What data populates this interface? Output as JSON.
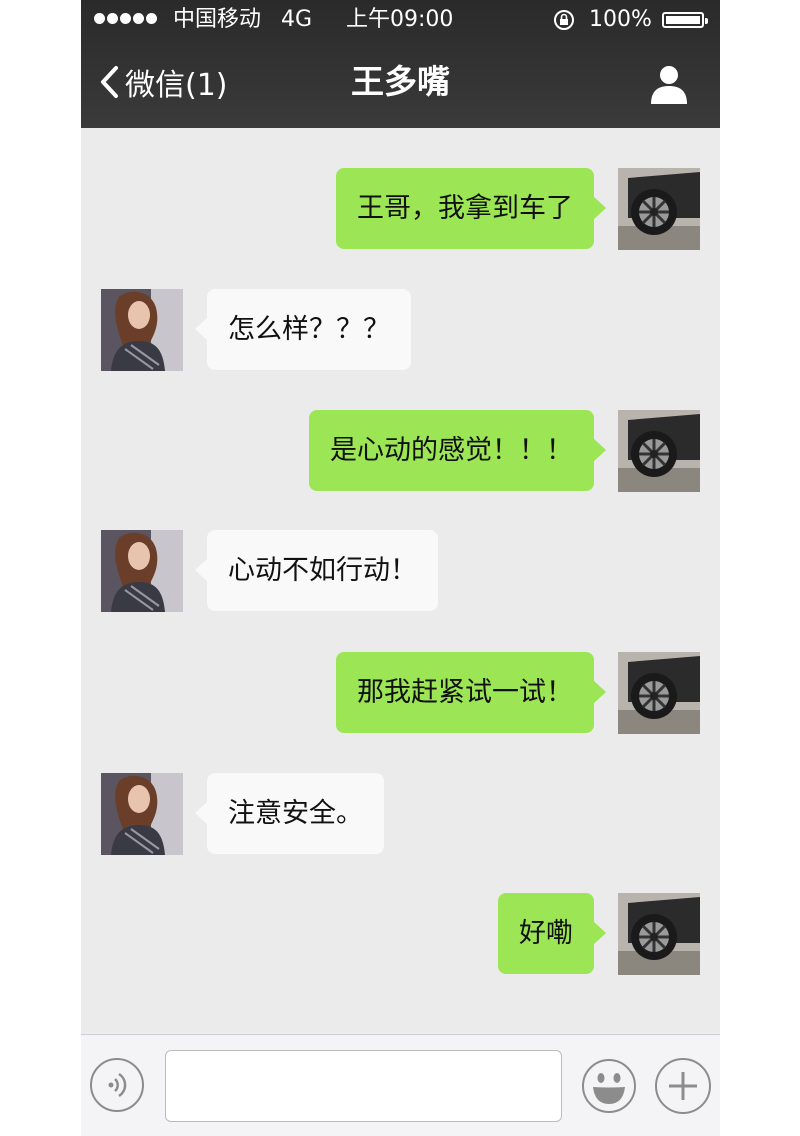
{
  "status_bar": {
    "carrier": "中国移动",
    "network": "4G",
    "time": "上午09:00",
    "battery": "100%"
  },
  "navbar": {
    "back_label": "微信(1)",
    "title": "王多嘴"
  },
  "messages": [
    {
      "sender": "me",
      "text": "王哥，我拿到车了"
    },
    {
      "sender": "her",
      "text": "怎么样？？？"
    },
    {
      "sender": "me",
      "text": "是心动的感觉！！！"
    },
    {
      "sender": "her",
      "text": "心动不如行动！"
    },
    {
      "sender": "me",
      "text": "那我赶紧试一试！"
    },
    {
      "sender": "her",
      "text": "注意安全。"
    },
    {
      "sender": "me",
      "text": "好嘞"
    }
  ],
  "input": {
    "placeholder": ""
  },
  "colors": {
    "header": "#333333",
    "chat_bg": "#ebebeb",
    "my_bubble": "#9ce554",
    "their_bubble": "#f9f9f9"
  },
  "icons": [
    "signal-dots-icon",
    "orientation-lock-icon",
    "battery-icon",
    "chevron-left-icon",
    "contact-profile-icon",
    "voice-icon",
    "emoji-icon",
    "plus-icon"
  ]
}
